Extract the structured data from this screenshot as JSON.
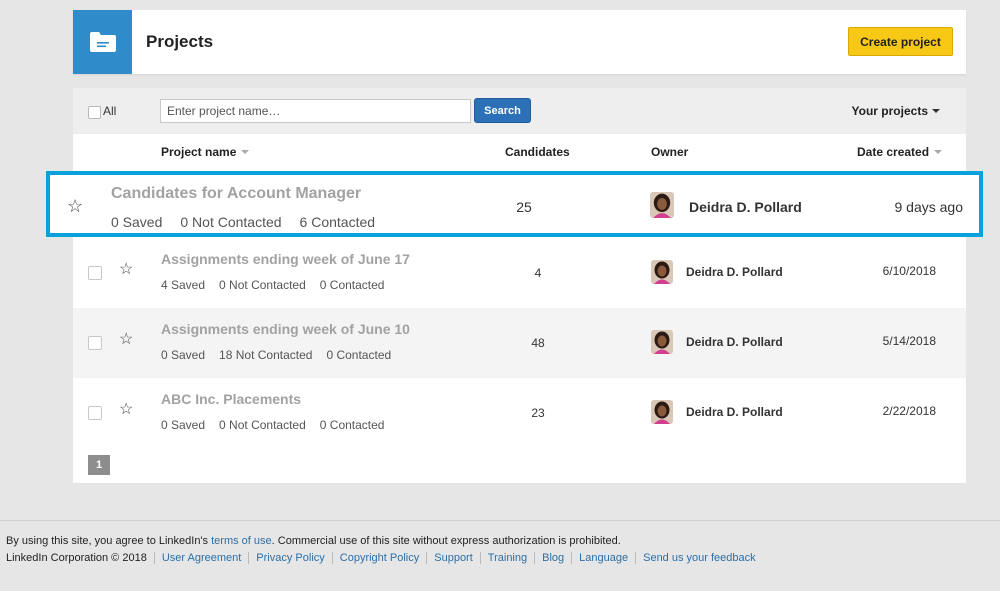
{
  "header": {
    "title": "Projects",
    "create_button": "Create project",
    "icon": "folder-icon"
  },
  "toolbar": {
    "all_label": "All",
    "search_placeholder": "Enter project name…",
    "search_button": "Search",
    "filter_label": "Your projects"
  },
  "columns": {
    "project_name": "Project name",
    "candidates": "Candidates",
    "owner": "Owner",
    "date_created": "Date created"
  },
  "rows": [
    {
      "name": "Candidates for Account Manager",
      "saved": "0 Saved",
      "not_contacted": "0 Not Contacted",
      "contacted": "6 Contacted",
      "candidates": "25",
      "owner": "Deidra D. Pollard",
      "date": "9 days ago",
      "highlighted": true
    },
    {
      "name": "Assignments ending week of June 17",
      "saved": "4 Saved",
      "not_contacted": "0 Not Contacted",
      "contacted": "0 Contacted",
      "candidates": "4",
      "owner": "Deidra D. Pollard",
      "date": "6/10/2018"
    },
    {
      "name": "Assignments ending week of June 10",
      "saved": "0 Saved",
      "not_contacted": "18 Not Contacted",
      "contacted": "0 Contacted",
      "candidates": "48",
      "owner": "Deidra D. Pollard",
      "date": "5/14/2018"
    },
    {
      "name": "ABC Inc. Placements",
      "saved": "0 Saved",
      "not_contacted": "0 Not Contacted",
      "contacted": "0 Contacted",
      "candidates": "23",
      "owner": "Deidra D. Pollard",
      "date": "2/22/2018"
    }
  ],
  "pagination": {
    "current_page": "1"
  },
  "footer": {
    "notice_prefix": "By using this site, you agree to LinkedIn's ",
    "notice_link": "terms of use",
    "notice_suffix": ". Commercial use of this site without express authorization is prohibited.",
    "copyright": "LinkedIn Corporation © 2018",
    "links": [
      "User Agreement",
      "Privacy Policy",
      "Copyright Policy",
      "Support",
      "Training",
      "Blog",
      "Language",
      "Send us your feedback"
    ]
  },
  "colors": {
    "accent": "#2f8bc9",
    "highlight_border": "#0aa1dd",
    "create_button": "#f7c815",
    "search_button": "#2c71b8",
    "link": "#2c6fa8"
  }
}
